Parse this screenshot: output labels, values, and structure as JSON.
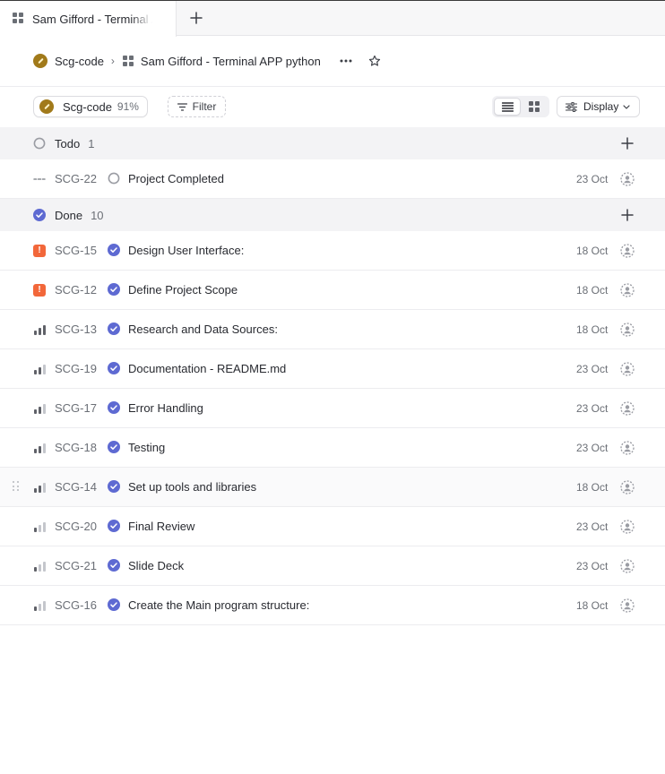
{
  "tab": {
    "title": "Sam Gifford - Terminal APP python"
  },
  "breadcrumb": {
    "team": "Scg-code",
    "separator": "›",
    "project": "Sam Gifford - Terminal APP python"
  },
  "toolbar": {
    "team_chip": {
      "label": "Scg-code",
      "percent": "91%"
    },
    "filter_label": "Filter",
    "display_label": "Display",
    "active_view": "list"
  },
  "colors": {
    "accent": "#5e6ad2",
    "urgent": "#f2673a",
    "team": "#a17a1a",
    "group_bg": "#f3f3f5"
  },
  "groups": [
    {
      "name": "Todo",
      "count": "1",
      "status_icon": "todo-circle-icon",
      "issues": [
        {
          "id": "SCG-22",
          "priority": "none",
          "status": "todo",
          "title": "Project Completed",
          "date": "23 Oct"
        }
      ]
    },
    {
      "name": "Done",
      "count": "10",
      "status_icon": "done-check-icon",
      "issues": [
        {
          "id": "SCG-15",
          "priority": "urgent",
          "status": "done",
          "title": "Design User Interface:",
          "date": "18 Oct"
        },
        {
          "id": "SCG-12",
          "priority": "urgent",
          "status": "done",
          "title": "Define Project Scope",
          "date": "18 Oct"
        },
        {
          "id": "SCG-13",
          "priority": "high",
          "status": "done",
          "title": "Research and Data Sources:",
          "date": "18 Oct"
        },
        {
          "id": "SCG-19",
          "priority": "medium",
          "status": "done",
          "title": "Documentation - README.md",
          "date": "23 Oct"
        },
        {
          "id": "SCG-17",
          "priority": "medium",
          "status": "done",
          "title": "Error Handling",
          "date": "23 Oct"
        },
        {
          "id": "SCG-18",
          "priority": "medium",
          "status": "done",
          "title": "Testing",
          "date": "23 Oct"
        },
        {
          "id": "SCG-14",
          "priority": "medium",
          "status": "done",
          "title": "Set up tools and libraries",
          "date": "18 Oct",
          "hovered": true
        },
        {
          "id": "SCG-20",
          "priority": "low",
          "status": "done",
          "title": "Final Review",
          "date": "23 Oct"
        },
        {
          "id": "SCG-21",
          "priority": "low",
          "status": "done",
          "title": "Slide Deck",
          "date": "23 Oct"
        },
        {
          "id": "SCG-16",
          "priority": "low",
          "status": "done",
          "title": "Create the Main program structure:",
          "date": "18 Oct"
        }
      ]
    }
  ]
}
